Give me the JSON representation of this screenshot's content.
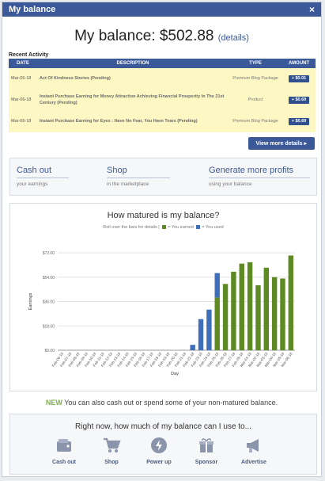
{
  "window": {
    "title": "My balance",
    "close_label": "×"
  },
  "balance": {
    "heading": "My balance: $502.88",
    "details_link": "(details)"
  },
  "recent": {
    "label": "Recent Activity",
    "columns": [
      "DATE",
      "DESCRIPTION",
      "TYPE",
      "AMOUNT"
    ],
    "rows": [
      {
        "date": "Mar-06-18",
        "description": "Act Of Kindness Stories (Pending)",
        "type": "Premium Blog Package",
        "amount": "+ $0.01"
      },
      {
        "date": "Mar-06-18",
        "description": "Instant Purchase Earning for Money Attraction Achieving Financial Prosperity In The 21st Century (Pending)",
        "type": "Product",
        "amount": "+ $0.69"
      },
      {
        "date": "Mar-06-18",
        "description": "Instant Purchase Earning for Eyes : Have No Fear, You Have Tears (Pending)",
        "type": "Premium Blog Package",
        "amount": "+ $0.69"
      }
    ],
    "view_more": "View more details ▸"
  },
  "links": [
    {
      "title_a": "Cash out",
      "title_b": "",
      "sub": "your earnings"
    },
    {
      "title_a": "Shop",
      "title_b": "",
      "sub": "in the marketplace"
    },
    {
      "title_a": "Generate",
      "title_b": " more profits",
      "sub": "using your balance"
    }
  ],
  "chart_data": {
    "type": "bar",
    "title": "How matured is my balance?",
    "legend_note": "Roll over the bars for details |",
    "xlabel": "Day",
    "ylabel": "Earnings",
    "ylim": [
      0,
      72
    ],
    "yticks": [
      "$0.00",
      "$18.00",
      "$36.00",
      "$54.00",
      "$72.00"
    ],
    "categories": [
      "Feb-06-18",
      "Feb-07-18",
      "Feb-08-18",
      "Feb-09-18",
      "Feb-10-18",
      "Feb-11-18",
      "Feb-12-18",
      "Feb-13-18",
      "Feb-14-18",
      "Feb-15-18",
      "Feb-16-18",
      "Feb-17-18",
      "Feb-18-18",
      "Feb-19-18",
      "Feb-20-18",
      "Feb-21-18",
      "Feb-22-18",
      "Feb-23-18",
      "Feb-24-18",
      "Feb-25-18",
      "Feb-26-18",
      "Feb-27-18",
      "Feb-28-18",
      "Mar-01-18",
      "Mar-02-18",
      "Mar-03-18",
      "Mar-04-18",
      "Mar-05-18",
      "Mar-06-18"
    ],
    "series": [
      {
        "name": "You earned",
        "color": "#5d8a22",
        "values": [
          0,
          0,
          0,
          0,
          0,
          0,
          0,
          0,
          0,
          0,
          0,
          0,
          0,
          0,
          0,
          0,
          0,
          0,
          0,
          0,
          0,
          0,
          0,
          0,
          0,
          0,
          0,
          0,
          0
        ]
      },
      {
        "name": "You used",
        "color": "#3f6fb8",
        "values": [
          0,
          0,
          0,
          0,
          0,
          0,
          0,
          0,
          0,
          0,
          0,
          0,
          0,
          0,
          0,
          0,
          4,
          23,
          30,
          18,
          0,
          0,
          0,
          0,
          0,
          0,
          0,
          0,
          0
        ]
      }
    ],
    "earned": [
      0,
      0,
      0,
      0,
      0,
      0,
      0,
      0,
      0,
      0,
      0,
      0,
      0,
      0,
      0,
      0,
      0,
      0,
      0,
      39,
      49,
      58,
      64,
      65,
      48,
      61,
      54,
      53,
      70,
      5
    ]
  },
  "footer_note": {
    "new": "NEW",
    "text": " You can also cash out or spend some of your non-matured balance."
  },
  "uses": {
    "title": "Right now, how much of my balance can I use to...",
    "items": [
      {
        "label": "Cash out",
        "icon": "wallet-icon"
      },
      {
        "label": "Shop",
        "icon": "cart-icon"
      },
      {
        "label": "Power up",
        "icon": "bolt-icon"
      },
      {
        "label": "Sponsor",
        "icon": "gift-icon"
      },
      {
        "label": "Advertise",
        "icon": "megaphone-icon"
      }
    ]
  }
}
